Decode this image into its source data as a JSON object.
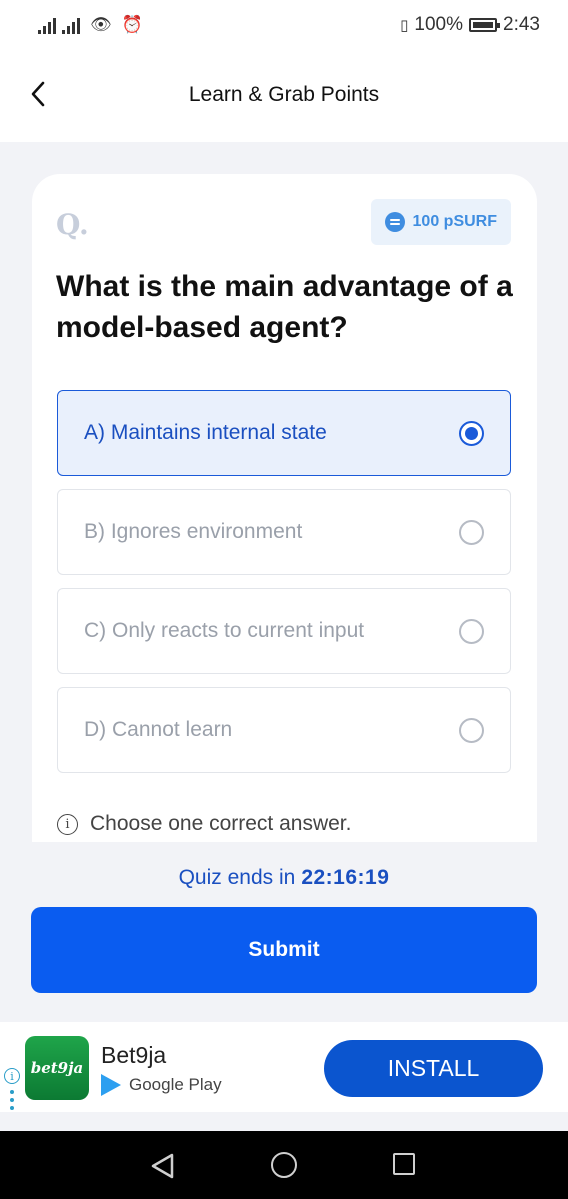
{
  "status_bar": {
    "battery": "100%",
    "time": "2:43"
  },
  "header": {
    "title": "Learn & Grab Points"
  },
  "quiz": {
    "q_mark": "Q.",
    "points": "100 pSURF",
    "question": "What is the main advantage of a model-based agent?",
    "options": [
      {
        "label": "A) Maintains internal state",
        "selected": true
      },
      {
        "label": "B) Ignores environment",
        "selected": false
      },
      {
        "label": "C) Only reacts to current input",
        "selected": false
      },
      {
        "label": "D) Cannot learn",
        "selected": false
      }
    ],
    "hint": "Choose one correct answer.",
    "timer_label": "Quiz ends in",
    "timer_value": "22:16:19",
    "submit_label": "Submit"
  },
  "ad": {
    "logo_text": "bet9ja",
    "app_name": "Bet9ja",
    "store": "Google Play",
    "install_label": "INSTALL"
  },
  "colors": {
    "primary": "#0a5cf0",
    "accent_text": "#1a4fc0",
    "badge_bg": "#eaf2fb",
    "ad_logo": "#1fa54a"
  }
}
